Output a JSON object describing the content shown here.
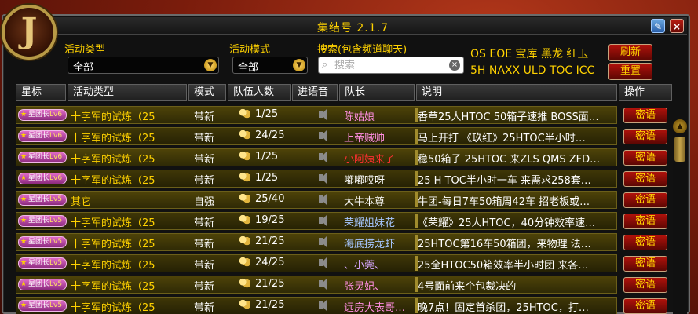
{
  "window": {
    "title": "集结号 2.1.7",
    "portrait_glyph": "J",
    "close": "×",
    "minimap": "✎"
  },
  "filters": {
    "activity_type_label": "活动类型",
    "activity_type_value": "全部",
    "activity_mode_label": "活动模式",
    "activity_mode_value": "全部",
    "search_label": "搜索(包含频道聊天)",
    "search_placeholder": "搜索",
    "quick_tags_line1": "OS EOE 宝库 黑龙 红玉",
    "quick_tags_line2": "5H NAXX ULD TOC ICC",
    "refresh_label": "刷新",
    "reset_label": "重置"
  },
  "table": {
    "headers": {
      "star": "星标",
      "type": "活动类型",
      "mode": "模式",
      "people": "队伍人数",
      "voice": "进语音",
      "leader": "队长",
      "desc": "说明",
      "action": "操作"
    },
    "rows": [
      {
        "badge": "星团长",
        "lv": "Lv6",
        "type": "十字军的试炼（25",
        "mode": "带新",
        "people": "1/25",
        "leader": "陈姑娘",
        "leader_color": "pink",
        "desc": "香草25人HTOC 50箱子速推 BOSS面…",
        "action": "密语"
      },
      {
        "badge": "星团长",
        "lv": "Lv6",
        "type": "十字军的试炼（25",
        "mode": "带新",
        "people": "24/25",
        "leader": "上帝贼帅",
        "leader_color": "pink",
        "desc": "马上开打 《玖红》25HTOC半小时…",
        "action": "密语"
      },
      {
        "badge": "星团长",
        "lv": "Lv6",
        "type": "十字军的试炼（25",
        "mode": "带新",
        "people": "1/25",
        "leader": "小阿姨来了",
        "leader_color": "red",
        "desc": "稳50箱子 25HTOC 来ZLS QMS ZFD…",
        "action": "密语"
      },
      {
        "badge": "星团长",
        "lv": "Lv6",
        "type": "十字军的试炼（25",
        "mode": "带新",
        "people": "1/25",
        "leader": "嘟嘟哎呀",
        "leader_color": "white",
        "desc": "25 H TOC半小时一车 来需求258套…",
        "action": "密语"
      },
      {
        "badge": "星团长",
        "lv": "Lv5",
        "type": "其它",
        "mode": "自强",
        "people": "25/40",
        "leader": "大牛本尊",
        "leader_color": "white",
        "desc": "牛团-每日7车50箱周42车 招老板或…",
        "action": "密语"
      },
      {
        "badge": "星团长",
        "lv": "Lv5",
        "type": "十字军的试炼（25",
        "mode": "带新",
        "people": "19/25",
        "leader": "荣耀姐妹花",
        "leader_color": "cyan",
        "desc": "《荣耀》25人HTOC，40分钟效率速…",
        "action": "密语"
      },
      {
        "badge": "星团长",
        "lv": "Lv5",
        "type": "十字军的试炼（25",
        "mode": "带新",
        "people": "21/25",
        "leader": "海底捞龙虾",
        "leader_color": "cyan",
        "desc": "25HTOC第16车50箱团，来物理 法…",
        "action": "密语"
      },
      {
        "badge": "星团长",
        "lv": "Lv5",
        "type": "十字军的试炼（25",
        "mode": "带新",
        "people": "24/25",
        "leader": "、小莞、",
        "leader_color": "lilac",
        "desc": "25全HTOC50箱效率半小时团 来各…",
        "action": "密语"
      },
      {
        "badge": "星团长",
        "lv": "Lv5",
        "type": "十字军的试炼（25",
        "mode": "带新",
        "people": "21/25",
        "leader": "张灵妃、",
        "leader_color": "pink",
        "desc": "4号面前来个包裁决的",
        "action": "密语"
      },
      {
        "badge": "星团长",
        "lv": "Lv5",
        "type": "十字军的试炼（25",
        "mode": "带新",
        "people": "21/25",
        "leader": "远房大表哥…",
        "leader_color": "pink",
        "desc": "晚7点！固定首杀团，25HTOC，打…",
        "action": "密语"
      }
    ]
  },
  "scrollbar": {
    "up": "▲"
  }
}
